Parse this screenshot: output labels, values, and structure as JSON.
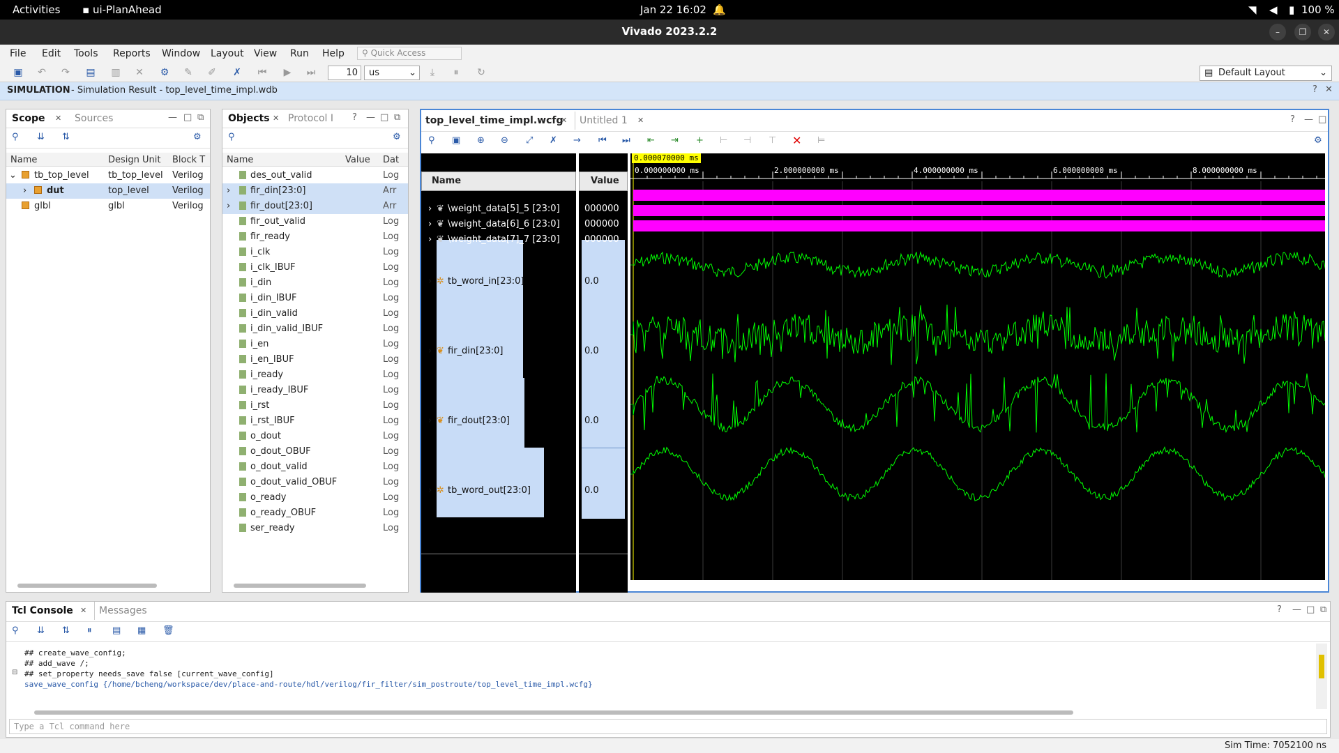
{
  "topbar": {
    "activities": "Activities",
    "app": "ui-PlanAhead",
    "clock": "Jan 22  16:02",
    "battery": "100 %"
  },
  "window": {
    "title": "Vivado 2023.2.2"
  },
  "menu": [
    "File",
    "Edit",
    "Tools",
    "Reports",
    "Window",
    "Layout",
    "View",
    "Run",
    "Help"
  ],
  "quick_access": "Quick Access",
  "toolbar": {
    "run_value": "10",
    "run_unit": "us",
    "layout": "Default Layout"
  },
  "simbar": {
    "label": "SIMULATION",
    "detail": "- Simulation Result - top_level_time_impl.wdb"
  },
  "scope": {
    "tabs": [
      "Scope",
      "Sources"
    ],
    "columns": [
      "Name",
      "Design Unit",
      "Block T"
    ],
    "rows": [
      {
        "name": "tb_top_level",
        "unit": "tb_top_level",
        "block": "Verilog"
      },
      {
        "name": "dut",
        "unit": "top_level",
        "block": "Verilog"
      },
      {
        "name": "glbl",
        "unit": "glbl",
        "block": "Verilog"
      }
    ]
  },
  "objects": {
    "tabs": [
      "Objects",
      "Protocol I"
    ],
    "columns": [
      "Name",
      "Value",
      "Dat"
    ],
    "rows": [
      {
        "name": "des_out_valid",
        "type": "Log"
      },
      {
        "name": "fir_din[23:0]",
        "type": "Arr"
      },
      {
        "name": "fir_dout[23:0]",
        "type": "Arr"
      },
      {
        "name": "fir_out_valid",
        "type": "Log"
      },
      {
        "name": "fir_ready",
        "type": "Log"
      },
      {
        "name": "i_clk",
        "type": "Log"
      },
      {
        "name": "i_clk_IBUF",
        "type": "Log"
      },
      {
        "name": "i_din",
        "type": "Log"
      },
      {
        "name": "i_din_IBUF",
        "type": "Log"
      },
      {
        "name": "i_din_valid",
        "type": "Log"
      },
      {
        "name": "i_din_valid_IBUF",
        "type": "Log"
      },
      {
        "name": "i_en",
        "type": "Log"
      },
      {
        "name": "i_en_IBUF",
        "type": "Log"
      },
      {
        "name": "i_ready",
        "type": "Log"
      },
      {
        "name": "i_ready_IBUF",
        "type": "Log"
      },
      {
        "name": "i_rst",
        "type": "Log"
      },
      {
        "name": "i_rst_IBUF",
        "type": "Log"
      },
      {
        "name": "o_dout",
        "type": "Log"
      },
      {
        "name": "o_dout_OBUF",
        "type": "Log"
      },
      {
        "name": "o_dout_valid",
        "type": "Log"
      },
      {
        "name": "o_dout_valid_OBUF",
        "type": "Log"
      },
      {
        "name": "o_ready",
        "type": "Log"
      },
      {
        "name": "o_ready_OBUF",
        "type": "Log"
      },
      {
        "name": "ser_ready",
        "type": "Log"
      }
    ]
  },
  "wave": {
    "tabs": [
      "top_level_time_impl.wcfg",
      "Untitled 1"
    ],
    "cursor": "0.000070000 ms",
    "name_header": "Name",
    "value_header": "Value",
    "time_ticks": [
      "0.000000000 ms",
      "2.000000000 ms",
      "4.000000000 ms",
      "6.000000000 ms",
      "8.000000000 ms"
    ],
    "signals": [
      {
        "name": "\\weight_data[5]_5 [23:0]",
        "value": "000000"
      },
      {
        "name": "\\weight_data[6]_6 [23:0]",
        "value": "000000"
      },
      {
        "name": "\\weight_data[7]_7 [23:0]",
        "value": "000000"
      },
      {
        "name": "tb_word_in[23:0]",
        "value": "0.0"
      },
      {
        "name": "fir_din[23:0]",
        "value": "0.0"
      },
      {
        "name": "fir_dout[23:0]",
        "value": "0.0"
      },
      {
        "name": "tb_word_out[23:0]",
        "value": "0.0"
      }
    ],
    "colors": {
      "bus": "#ff00ff",
      "analog": "#00ff00",
      "grid": "#3a3a3a"
    }
  },
  "console": {
    "tabs": [
      "Tcl Console",
      "Messages"
    ],
    "lines": [
      "## create_wave_config;",
      "## add_wave /;",
      "## set_property needs_save false [current_wave_config]"
    ],
    "link": "save_wave_config {/home/bcheng/workspace/dev/place-and-route/hdl/verilog/fir_filter/sim_postroute/top_level_time_impl.wcfg}",
    "placeholder": "Type a Tcl command here"
  },
  "status": {
    "sim_time": "Sim Time: 7052100 ns"
  }
}
